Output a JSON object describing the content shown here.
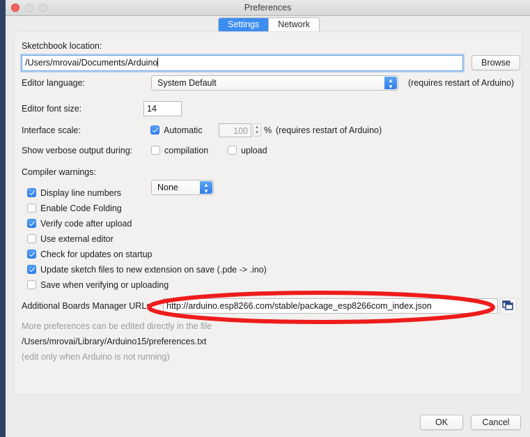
{
  "window": {
    "title": "Preferences",
    "traffic_lights": [
      "close",
      "minimize",
      "maximize"
    ]
  },
  "tabs": [
    {
      "label": "Settings",
      "active": true
    },
    {
      "label": "Network",
      "active": false
    }
  ],
  "form": {
    "sketchbook": {
      "label": "Sketchbook location:",
      "value": "/Users/mrovai/Documents/Arduino",
      "browse_label": "Browse"
    },
    "editor_language": {
      "label": "Editor language:",
      "value": "System Default",
      "note": "(requires restart of Arduino)"
    },
    "editor_font_size": {
      "label": "Editor font size:",
      "value": "14"
    },
    "interface_scale": {
      "label": "Interface scale:",
      "automatic_label": "Automatic",
      "automatic_checked": true,
      "scale_value": "100",
      "percent_sign": "%",
      "note": "(requires restart of Arduino)"
    },
    "verbose_output": {
      "label": "Show verbose output during:",
      "compilation_label": "compilation",
      "compilation_checked": false,
      "upload_label": "upload",
      "upload_checked": false
    },
    "compiler_warnings": {
      "label": "Compiler warnings:",
      "value": "None"
    },
    "checkboxes": [
      {
        "label": "Display line numbers",
        "checked": true
      },
      {
        "label": "Enable Code Folding",
        "checked": false
      },
      {
        "label": "Verify code after upload",
        "checked": true
      },
      {
        "label": "Use external editor",
        "checked": false
      },
      {
        "label": "Check for updates on startup",
        "checked": true
      },
      {
        "label": "Update sketch files to new extension on save (.pde -> .ino)",
        "checked": true
      },
      {
        "label": "Save when verifying or uploading",
        "checked": false
      }
    ],
    "boards_manager": {
      "label": "Additional Boards Manager URLs:",
      "value": "http://arduino.esp8266.com/stable/package_esp8266com_index.json"
    },
    "footnote": {
      "line1": "More preferences can be edited directly in the file",
      "line2": "/Users/mrovai/Library/Arduino15/preferences.txt",
      "line3": "(edit only when Arduino is not running)"
    }
  },
  "buttons": {
    "ok": "OK",
    "cancel": "Cancel"
  },
  "annotation": {
    "shape": "ellipse",
    "color": "#ee1c1c",
    "target": "Additional Boards Manager URLs field"
  },
  "colors": {
    "accent_blue": "#3c8df0",
    "annotation_red": "#ee1c1c",
    "window_bg": "#ececec",
    "panel_bg": "#f2f1f0"
  }
}
